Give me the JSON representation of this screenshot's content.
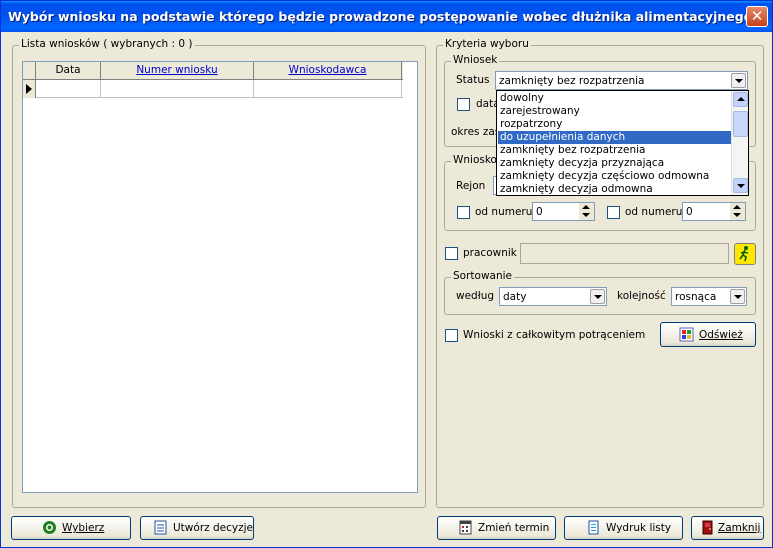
{
  "window": {
    "title": "Wybór wniosku na podstawie którego będzie prowadzone postępowanie wobec dłużnika alimentacyjnego",
    "close_glyph": "✕"
  },
  "list": {
    "group_title": "Lista wniosków ( wybranych : 0 )",
    "columns": [
      "Data",
      "Numer wniosku",
      "Wnioskodawca"
    ]
  },
  "criteria": {
    "group_title": "Kryteria wyboru",
    "wniosek": {
      "title": "Wniosek",
      "status_label": "Status",
      "status_value": "zamknięty bez rozpatrzenia",
      "date_label": "data",
      "period_label": "okres zas",
      "status_options": [
        "dowolny",
        "zarejestrowany",
        "rozpatrzony",
        "do uzupełnienia danych",
        "zamknięty bez rozpatrzenia",
        "zamknięty decyzja przyznająca",
        "zamknięty decyzja częściowo odmowna",
        "zamknięty decyzja odmowna"
      ],
      "highlighted_option": "do uzupełnienia danych"
    },
    "wnioskodawca": {
      "title": "Wnioskod",
      "rejon_label": "Rejon",
      "from_number_label_1": "od numeru",
      "from_number_value_1": "0",
      "from_number_label_2": "od numeru",
      "from_number_value_2": "0"
    },
    "worker_label": "pracownik",
    "sorting": {
      "title": "Sortowanie",
      "by_label": "według",
      "by_value": "daty",
      "order_label": "kolejność",
      "order_value": "rosnąca"
    },
    "full_deduction_label": "Wnioski z całkowitym potrąceniem",
    "refresh_label": "Odśwież"
  },
  "buttons": {
    "select": "Wybierz",
    "create_decisions": "Utwórz decyzje",
    "change_term": "Zmień termin",
    "print_list": "Wydruk listy",
    "close": "Zamknij"
  },
  "colors": {
    "title_bar": "#0053ee",
    "selection": "#316ac5",
    "link": "#0000cc",
    "face": "#ece9d8"
  }
}
